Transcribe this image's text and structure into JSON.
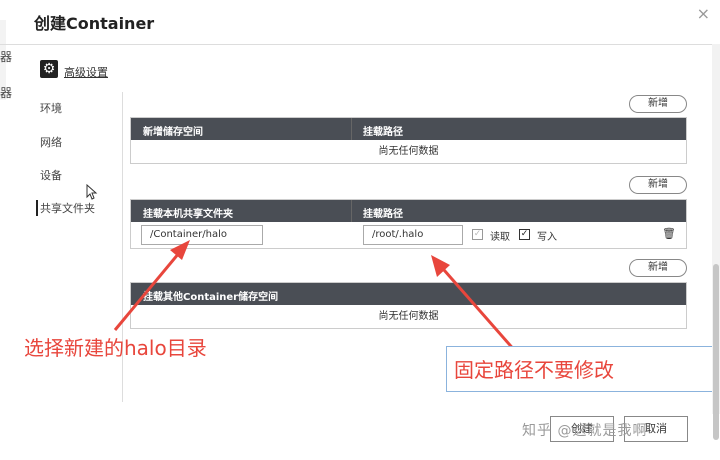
{
  "dialog": {
    "title": "创建Container",
    "close": "×"
  },
  "edge_labels": {
    "top": "器",
    "mid": "器"
  },
  "advanced": {
    "label": "高级设置"
  },
  "sidebar": {
    "items": [
      {
        "label": "环境"
      },
      {
        "label": "网络"
      },
      {
        "label": "设备"
      },
      {
        "label": "共享文件夹"
      }
    ]
  },
  "section1": {
    "add_label": "新增",
    "col1": "新增储存空间",
    "col2": "挂载路径",
    "empty": "尚无任何数据"
  },
  "section2": {
    "add_label": "新增",
    "col1": "挂载本机共享文件夹",
    "col2": "挂载路径",
    "row": {
      "host_path": "/Container/halo",
      "mount_path": "/root/.halo",
      "read_label": "读取",
      "read_checked": false,
      "write_label": "写入",
      "write_checked": true
    }
  },
  "section3": {
    "add_label": "新增",
    "col1": "挂载其他Container储存空间",
    "empty": "尚无任何数据"
  },
  "annotations": {
    "left": "选择新建的halo目录",
    "right": "固定路径不要修改",
    "color": "#e8463c"
  },
  "footer": {
    "create_label": "创建",
    "cancel_label": "取消"
  },
  "watermark": "知乎 @这就是我啊",
  "colors": {
    "header_bg": "#4a4e55",
    "arrow": "#e8463c"
  }
}
